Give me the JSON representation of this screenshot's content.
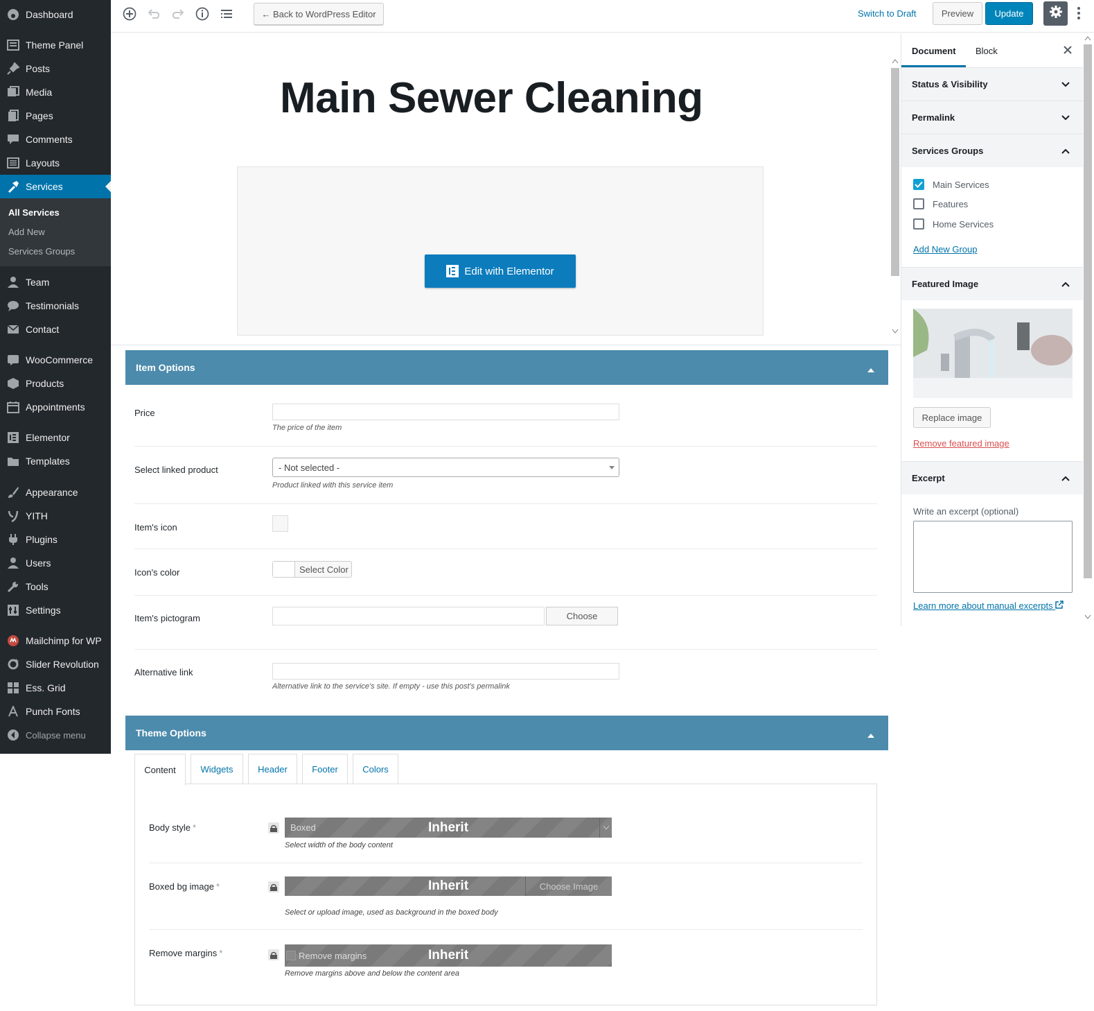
{
  "sidebar": {
    "items": [
      {
        "label": "Dashboard",
        "icon": "dashboard-icon"
      },
      {
        "label": "Theme Panel",
        "icon": "theme-panel-icon"
      },
      {
        "label": "Posts",
        "icon": "pin-icon"
      },
      {
        "label": "Media",
        "icon": "media-icon"
      },
      {
        "label": "Pages",
        "icon": "pages-icon"
      },
      {
        "label": "Comments",
        "icon": "comments-icon"
      },
      {
        "label": "Layouts",
        "icon": "layouts-icon"
      },
      {
        "label": "Services",
        "icon": "hammer-icon"
      },
      {
        "label": "Team",
        "icon": "user-icon"
      },
      {
        "label": "Testimonials",
        "icon": "speech-icon"
      },
      {
        "label": "Contact",
        "icon": "mail-icon"
      },
      {
        "label": "WooCommerce",
        "icon": "woo-icon"
      },
      {
        "label": "Products",
        "icon": "box-icon"
      },
      {
        "label": "Appointments",
        "icon": "calendar-icon"
      },
      {
        "label": "Elementor",
        "icon": "elementor-icon"
      },
      {
        "label": "Templates",
        "icon": "folder-icon"
      },
      {
        "label": "Appearance",
        "icon": "brush-icon"
      },
      {
        "label": "YITH",
        "icon": "yith-icon"
      },
      {
        "label": "Plugins",
        "icon": "plug-icon"
      },
      {
        "label": "Users",
        "icon": "users-icon"
      },
      {
        "label": "Tools",
        "icon": "wrench-icon"
      },
      {
        "label": "Settings",
        "icon": "settings-icon"
      },
      {
        "label": "Mailchimp for WP",
        "icon": "mailchimp-icon"
      },
      {
        "label": "Slider Revolution",
        "icon": "refresh-icon"
      },
      {
        "label": "Ess. Grid",
        "icon": "grid-icon"
      },
      {
        "label": "Punch Fonts",
        "icon": "font-icon"
      },
      {
        "label": "Collapse menu",
        "icon": "collapse-icon"
      }
    ],
    "submenu": [
      "All Services",
      "Add New",
      "Services Groups"
    ]
  },
  "toolbar": {
    "back": "← Back to WordPress Editor",
    "switch_draft": "Switch to Draft",
    "preview": "Preview",
    "update": "Update"
  },
  "editor": {
    "title": "Main Sewer Cleaning",
    "elementor_btn": "Edit with Elementor"
  },
  "panel": {
    "tab_document": "Document",
    "tab_block": "Block",
    "status": "Status & Visibility",
    "permalink": "Permalink",
    "groups": "Services Groups",
    "group_items": [
      {
        "label": "Main Services",
        "checked": true
      },
      {
        "label": "Features",
        "checked": false
      },
      {
        "label": "Home Services",
        "checked": false
      }
    ],
    "add_group": "Add New Group",
    "featured": "Featured Image",
    "replace": "Replace image",
    "remove": "Remove featured image",
    "excerpt": "Excerpt",
    "excerpt_label": "Write an excerpt (optional)",
    "learn": "Learn more about manual excerpts"
  },
  "item_options": {
    "title": "Item Options",
    "price_label": "Price",
    "price_desc": "The price of the item",
    "linked_label": "Select linked product",
    "linked_value": "- Not selected -",
    "linked_desc": "Product linked with this service item",
    "icon_label": "Item's icon",
    "color_label": "Icon's color",
    "color_btn": "Select Color",
    "picto_label": "Item's pictogram",
    "picto_btn": "Choose",
    "alt_label": "Alternative link",
    "alt_desc": "Alternative link to the service's site. If empty - use this post's permalink"
  },
  "theme_options": {
    "title": "Theme Options",
    "tabs": [
      "Content",
      "Widgets",
      "Header",
      "Footer",
      "Colors"
    ],
    "body_label": "Body style",
    "body_value": "Boxed",
    "body_desc": "Select width of the body content",
    "bg_label": "Boxed bg image",
    "bg_btn": "Choose Image",
    "bg_desc": "Select or upload image, used as background in the boxed body",
    "margins_label": "Remove margins",
    "margins_cb": "Remove margins",
    "margins_desc": "Remove margins above and below the content area",
    "inherit": "Inherit",
    "star": "*"
  },
  "colors": {
    "sidebar": "#23282d",
    "active": "#0073aa",
    "metabox": "#4c8bac",
    "update": "#0085ba"
  }
}
